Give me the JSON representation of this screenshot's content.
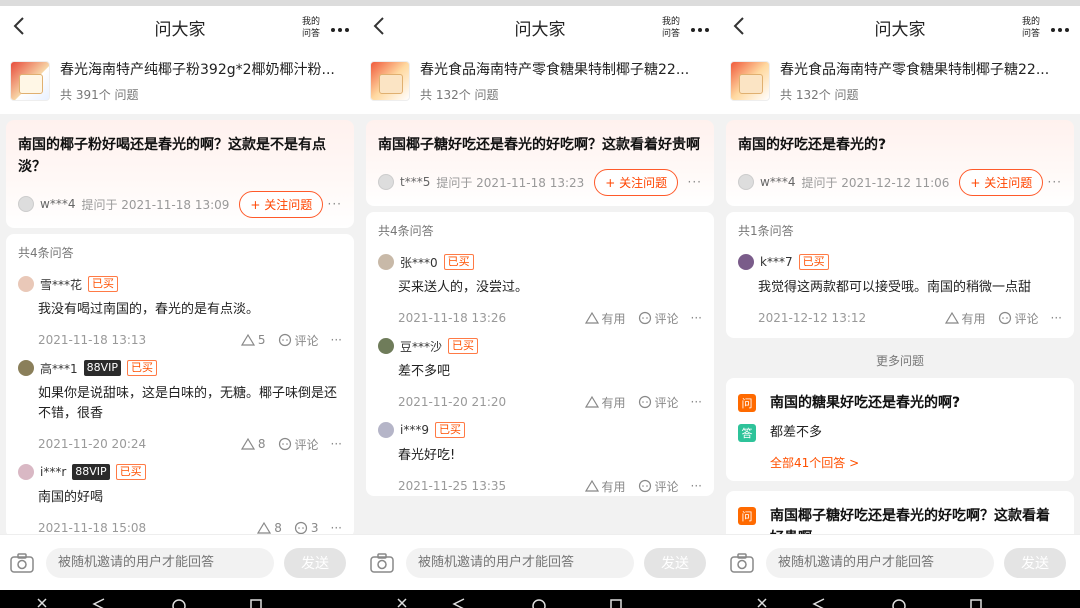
{
  "colors": {
    "accent": "#ff5000",
    "bought": "#ff7a45",
    "answer_tag": "#2ec39a",
    "question_tag": "#ff6a00"
  },
  "panels": [
    {
      "header": {
        "title": "问大家",
        "my_qa_line1": "我的",
        "my_qa_line2": "问答"
      },
      "product": {
        "title": "春光海南特产纯椰子粉392g*2椰奶椰汁粉...",
        "count": "共 391个 问题"
      },
      "question": {
        "text": "南国的椰子粉好喝还是春光的啊？这款是不是有点淡？",
        "asker": "w***4",
        "asked_at": "提问于 2021-11-18 13:09",
        "follow_label": "+ 关注问题"
      },
      "answers_count": "共4条问答",
      "answers": [
        {
          "user": "雪***花",
          "vip": "",
          "bought": "已买",
          "text": "我没有喝过南国的，春光的是有点淡。",
          "date": "2021-11-18 13:13",
          "likes": "5",
          "comments": "评论"
        },
        {
          "user": "高***1",
          "vip": "88VIP",
          "bought": "已买",
          "text": "如果你是说甜味，这是白味的，无糖。椰子味倒是还不错，很香",
          "date": "2021-11-20 20:24",
          "likes": "8",
          "comments": "评论"
        },
        {
          "user": "i***r",
          "vip": "88VIP",
          "bought": "已买",
          "text": "南国的好喝",
          "date": "2021-11-18 15:08",
          "likes": "8",
          "comments": "3"
        }
      ],
      "input": {
        "placeholder": "被随机邀请的用户才能回答",
        "send": "发送"
      }
    },
    {
      "header": {
        "title": "问大家",
        "my_qa_line1": "我的",
        "my_qa_line2": "问答"
      },
      "product": {
        "title": "春光食品海南特产零食糖果特制椰子糖22...",
        "count": "共 132个 问题"
      },
      "question": {
        "text": "南国椰子糖好吃还是春光的好吃啊？这款看着好贵啊",
        "asker": "t***5",
        "asked_at": "提问于 2021-11-18 13:23",
        "follow_label": "+ 关注问题"
      },
      "answers_count": "共4条问答",
      "answers": [
        {
          "user": "张***0",
          "vip": "",
          "bought": "已买",
          "text": "买来送人的，没尝过。",
          "date": "2021-11-18 13:26",
          "likes": "有用",
          "comments": "评论"
        },
        {
          "user": "豆***沙",
          "vip": "",
          "bought": "已买",
          "text": "差不多吧",
          "date": "2021-11-20 21:20",
          "likes": "有用",
          "comments": "评论"
        },
        {
          "user": "i***9",
          "vip": "",
          "bought": "已买",
          "text": "春光好吃!",
          "date": "2021-11-25 13:35",
          "likes": "有用",
          "comments": "评论"
        }
      ],
      "input": {
        "placeholder": "被随机邀请的用户才能回答",
        "send": "发送"
      }
    },
    {
      "header": {
        "title": "问大家",
        "my_qa_line1": "我的",
        "my_qa_line2": "问答"
      },
      "product": {
        "title": "春光食品海南特产零食糖果特制椰子糖22...",
        "count": "共 132个 问题"
      },
      "question": {
        "text": "南国的好吃还是春光的?",
        "asker": "w***4",
        "asked_at": "提问于 2021-12-12 11:06",
        "follow_label": "+ 关注问题"
      },
      "answers_count": "共1条问答",
      "answers": [
        {
          "user": "k***7",
          "vip": "",
          "bought": "已买",
          "text": "我觉得这两款都可以接受哦。南国的稍微一点甜",
          "date": "2021-12-12 13:12",
          "likes": "有用",
          "comments": "评论"
        }
      ],
      "more_label": "更多问题",
      "more_questions": [
        {
          "q_tag": "问",
          "question": "南国的糖果好吃还是春光的啊?",
          "a_tag": "答",
          "answer": "都差不多",
          "all_link": "全部41个回答 >"
        },
        {
          "q_tag": "问",
          "question": "南国椰子糖好吃还是春光的好吃啊？这款看着好贵啊"
        }
      ],
      "input": {
        "placeholder": "被随机邀请的用户才能回答",
        "send": "发送"
      }
    }
  ],
  "icons": {
    "back": "chevron-left-icon",
    "more": "ellipsis-icon",
    "like": "triangle-up-icon",
    "comment": "speech-bubble-icon",
    "camera": "camera-icon",
    "nav": [
      "close-icon",
      "back-triangle-icon",
      "home-circle-icon",
      "recents-square-icon"
    ]
  }
}
